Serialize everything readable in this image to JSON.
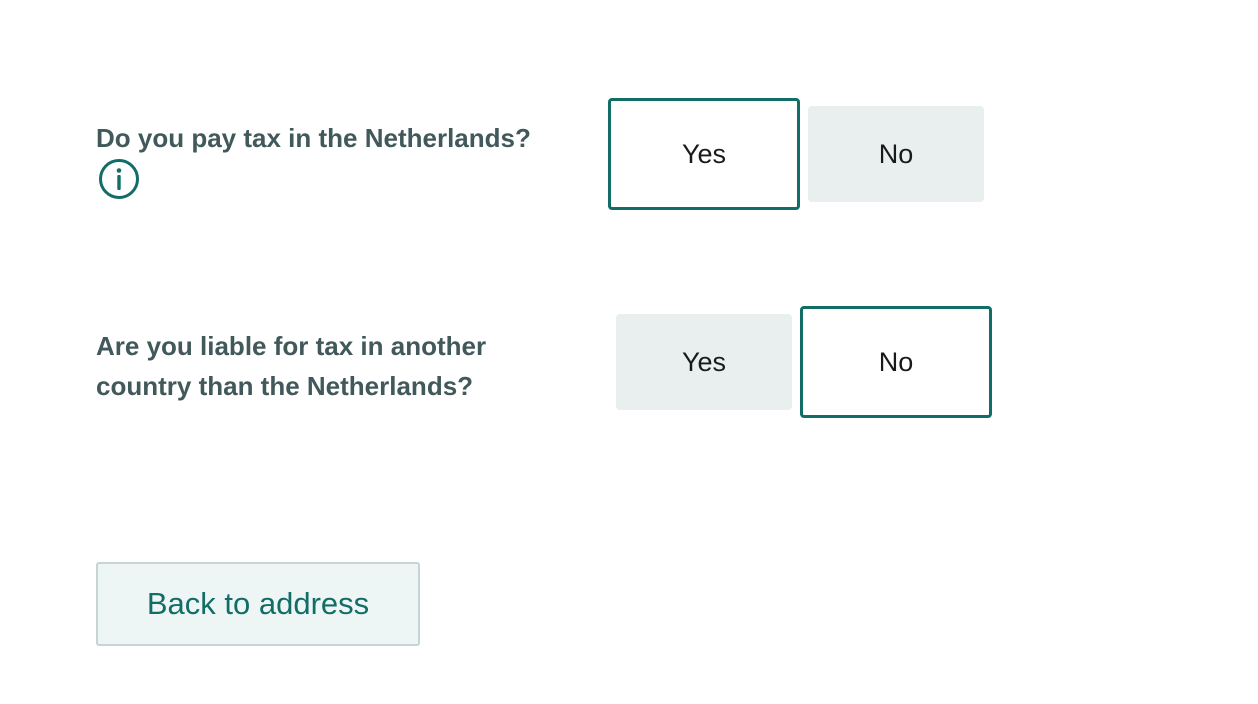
{
  "colors": {
    "accent": "#126d67",
    "question_text": "#41595b",
    "unselected_bg": "#e8efee",
    "secondary_button_bg": "#eef6f5"
  },
  "questions": [
    {
      "label": "Do you pay tax in the Netherlands?",
      "has_info_icon": true,
      "info_icon": "info-icon",
      "options": [
        {
          "label": "Yes",
          "selected": true
        },
        {
          "label": "No",
          "selected": false
        }
      ]
    },
    {
      "label": "Are you liable for tax in another country than the Netherlands?",
      "has_info_icon": false,
      "options": [
        {
          "label": "Yes",
          "selected": false
        },
        {
          "label": "No",
          "selected": true
        }
      ]
    }
  ],
  "actions": {
    "back_label": "Back to address"
  }
}
